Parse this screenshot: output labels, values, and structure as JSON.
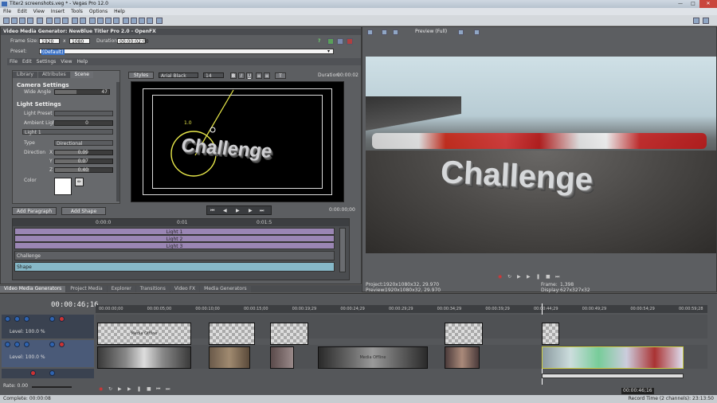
{
  "window": {
    "title": "Titer2 screenshots.veg * - Vegas Pro 12.0"
  },
  "menu": [
    "File",
    "Edit",
    "View",
    "Insert",
    "Tools",
    "Options",
    "Help"
  ],
  "vmg": {
    "header": "Video Media Generator: NewBlue Titler Pro 2.0 - OpenFX",
    "frame_label": "Frame Size:",
    "width": "1920",
    "x": "x",
    "height": "1080",
    "duration_label": "Duration:",
    "duration": "00:00:02;00",
    "preset_label": "Preset:",
    "preset": "(Default)"
  },
  "titler": {
    "menu": [
      "File",
      "Edit",
      "Settings",
      "View",
      "Help"
    ],
    "tabs": [
      "Library",
      "Attributes",
      "Scene"
    ],
    "camera_title": "Camera Settings",
    "wide_angle_label": "Wide Angle",
    "wide_angle": "47",
    "light_title": "Light Settings",
    "light_preset_label": "Light Preset",
    "ambient_label": "Ambient Light",
    "ambient": "0",
    "light_select": "Light 1",
    "type_label": "Type",
    "type": "Directional",
    "direction_label": "Direction",
    "x_label": "X",
    "x": "0.09",
    "y_label": "Y",
    "y": "0.07",
    "z_label": "Z",
    "z": "0.40",
    "color_label": "Color",
    "styles_btn": "Styles",
    "font": "Arial Black",
    "font_size": "14",
    "duration_label": "Duration:",
    "duration": "00:00:02",
    "canvas_text": "Challenge",
    "light_marker": "1.0",
    "add_paragraph": "Add Paragraph",
    "add_shape": "Add Shape",
    "timecode": "0:00:00;00",
    "ruler": [
      "0:00:0",
      "0:01",
      "0:01:5"
    ],
    "tracks": [
      "Light 1",
      "Light 2",
      "Light 3",
      "Challenge",
      "Shape"
    ]
  },
  "preview": {
    "mode": "Preview (Full)",
    "overlay_text": "Challenge",
    "project_label": "Project:",
    "project": "1920x1080x32, 29.970",
    "preview_label": "Preview:",
    "preview_val": "1920x1080x32, 29.970",
    "frame_label": "Frame:",
    "frame": "1,398",
    "display_label": "Display:",
    "display": "627x327x32"
  },
  "doc_tabs": [
    "Video Media Generators",
    "Project Media",
    "Explorer",
    "Transitions",
    "Video FX",
    "Media Generators"
  ],
  "timeline": {
    "timecode": "00:00:46;16",
    "ruler": [
      "00:00:00;00",
      "00:00:05;00",
      "00:00:10;00",
      "00:00:15;00",
      "00:00:19;29",
      "00:00:24;29",
      "00:00:29;29",
      "00:00:34;29",
      "00:00:39;29",
      "00:00:44;29",
      "00:00:49;29",
      "00:00:54;29",
      "00:00:59;28"
    ],
    "level1": "Level: 100.0 %",
    "level2": "Level: 100.0 %",
    "media_offline": "Media Offline",
    "rate": "Rate: 0.00",
    "end_timecode": "00:00:46;16",
    "record_time": "Record Time (2 channels): 23:13:50"
  },
  "status": {
    "complete": "Complete: 00:00:08"
  },
  "colors": {
    "accent": "#2f64b0",
    "track_purple": "#9a86b4",
    "track_teal": "#86b8c8"
  }
}
